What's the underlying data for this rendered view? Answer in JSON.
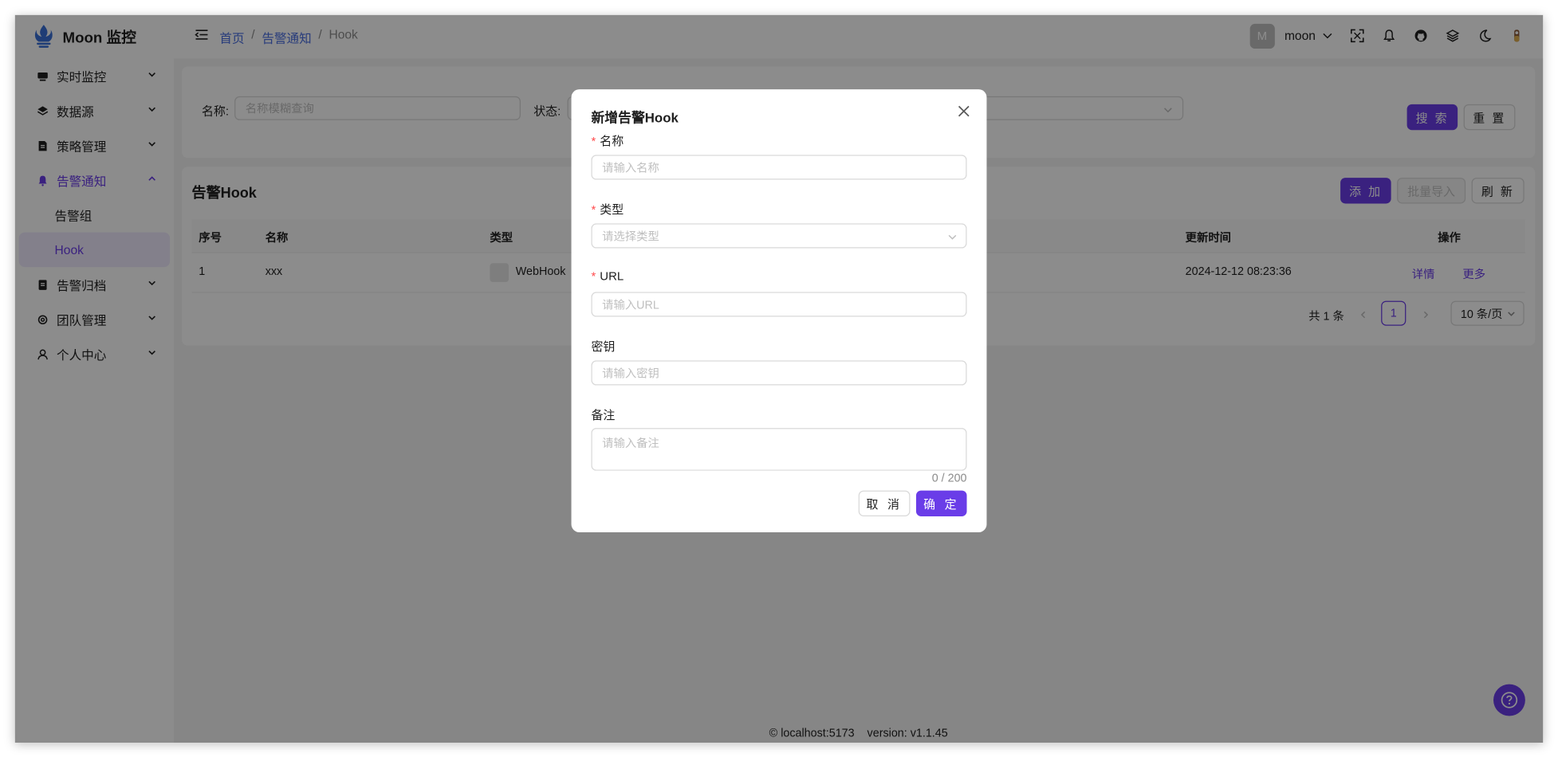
{
  "app": {
    "logo_text": "Moon 监控"
  },
  "sidebar": {
    "items": [
      {
        "label": "实时监控",
        "icon": "monitor-icon"
      },
      {
        "label": "数据源",
        "icon": "layers-icon"
      },
      {
        "label": "策略管理",
        "icon": "document-icon"
      },
      {
        "label": "告警通知",
        "icon": "bell-icon",
        "open": true
      },
      {
        "label": "告警归档",
        "icon": "archive-icon"
      },
      {
        "label": "团队管理",
        "icon": "gear-icon"
      },
      {
        "label": "个人中心",
        "icon": "user-icon"
      }
    ],
    "sub_items": [
      {
        "label": "告警组"
      },
      {
        "label": "Hook",
        "active": true
      }
    ]
  },
  "header": {
    "breadcrumb": [
      "首页",
      "告警通知",
      "Hook"
    ],
    "separator": "/",
    "avatar_letter": "M",
    "username": "moon"
  },
  "search": {
    "name_label": "名称:",
    "name_placeholder": "名称模糊查询",
    "status_label": "状态:",
    "search_button": "搜 索",
    "reset_button": "重 置"
  },
  "table": {
    "title": "告警Hook",
    "add_button": "添 加",
    "import_button": "批量导入",
    "refresh_button": "刷 新",
    "columns": [
      "序号",
      "名称",
      "类型",
      "更新时间",
      "操作"
    ],
    "rows": [
      {
        "index": "1",
        "name": "xxx",
        "type": "WebHook",
        "updated": "2024-12-12 08:23:36",
        "action_detail": "详情",
        "action_more": "更多"
      }
    ],
    "pagination": {
      "total": "共 1 条",
      "current_page": "1",
      "page_size": "10 条/页"
    }
  },
  "footer": {
    "host": "localhost:5173",
    "version": "version: v1.1.45"
  },
  "modal": {
    "title": "新增告警Hook",
    "fields": {
      "name_label": "名称",
      "name_placeholder": "请输入名称",
      "type_label": "类型",
      "type_placeholder": "请选择类型",
      "url_label": "URL",
      "url_placeholder": "请输入URL",
      "secret_label": "密钥",
      "secret_placeholder": "请输入密钥",
      "remark_label": "备注",
      "remark_placeholder": "请输入备注",
      "remark_count": "0 / 200"
    },
    "required_mark": "*",
    "cancel_button": "取 消",
    "ok_button": "确 定"
  },
  "colors": {
    "primary": "#6a3de8",
    "link": "#4a6ee0",
    "required": "#ff4d4f"
  }
}
